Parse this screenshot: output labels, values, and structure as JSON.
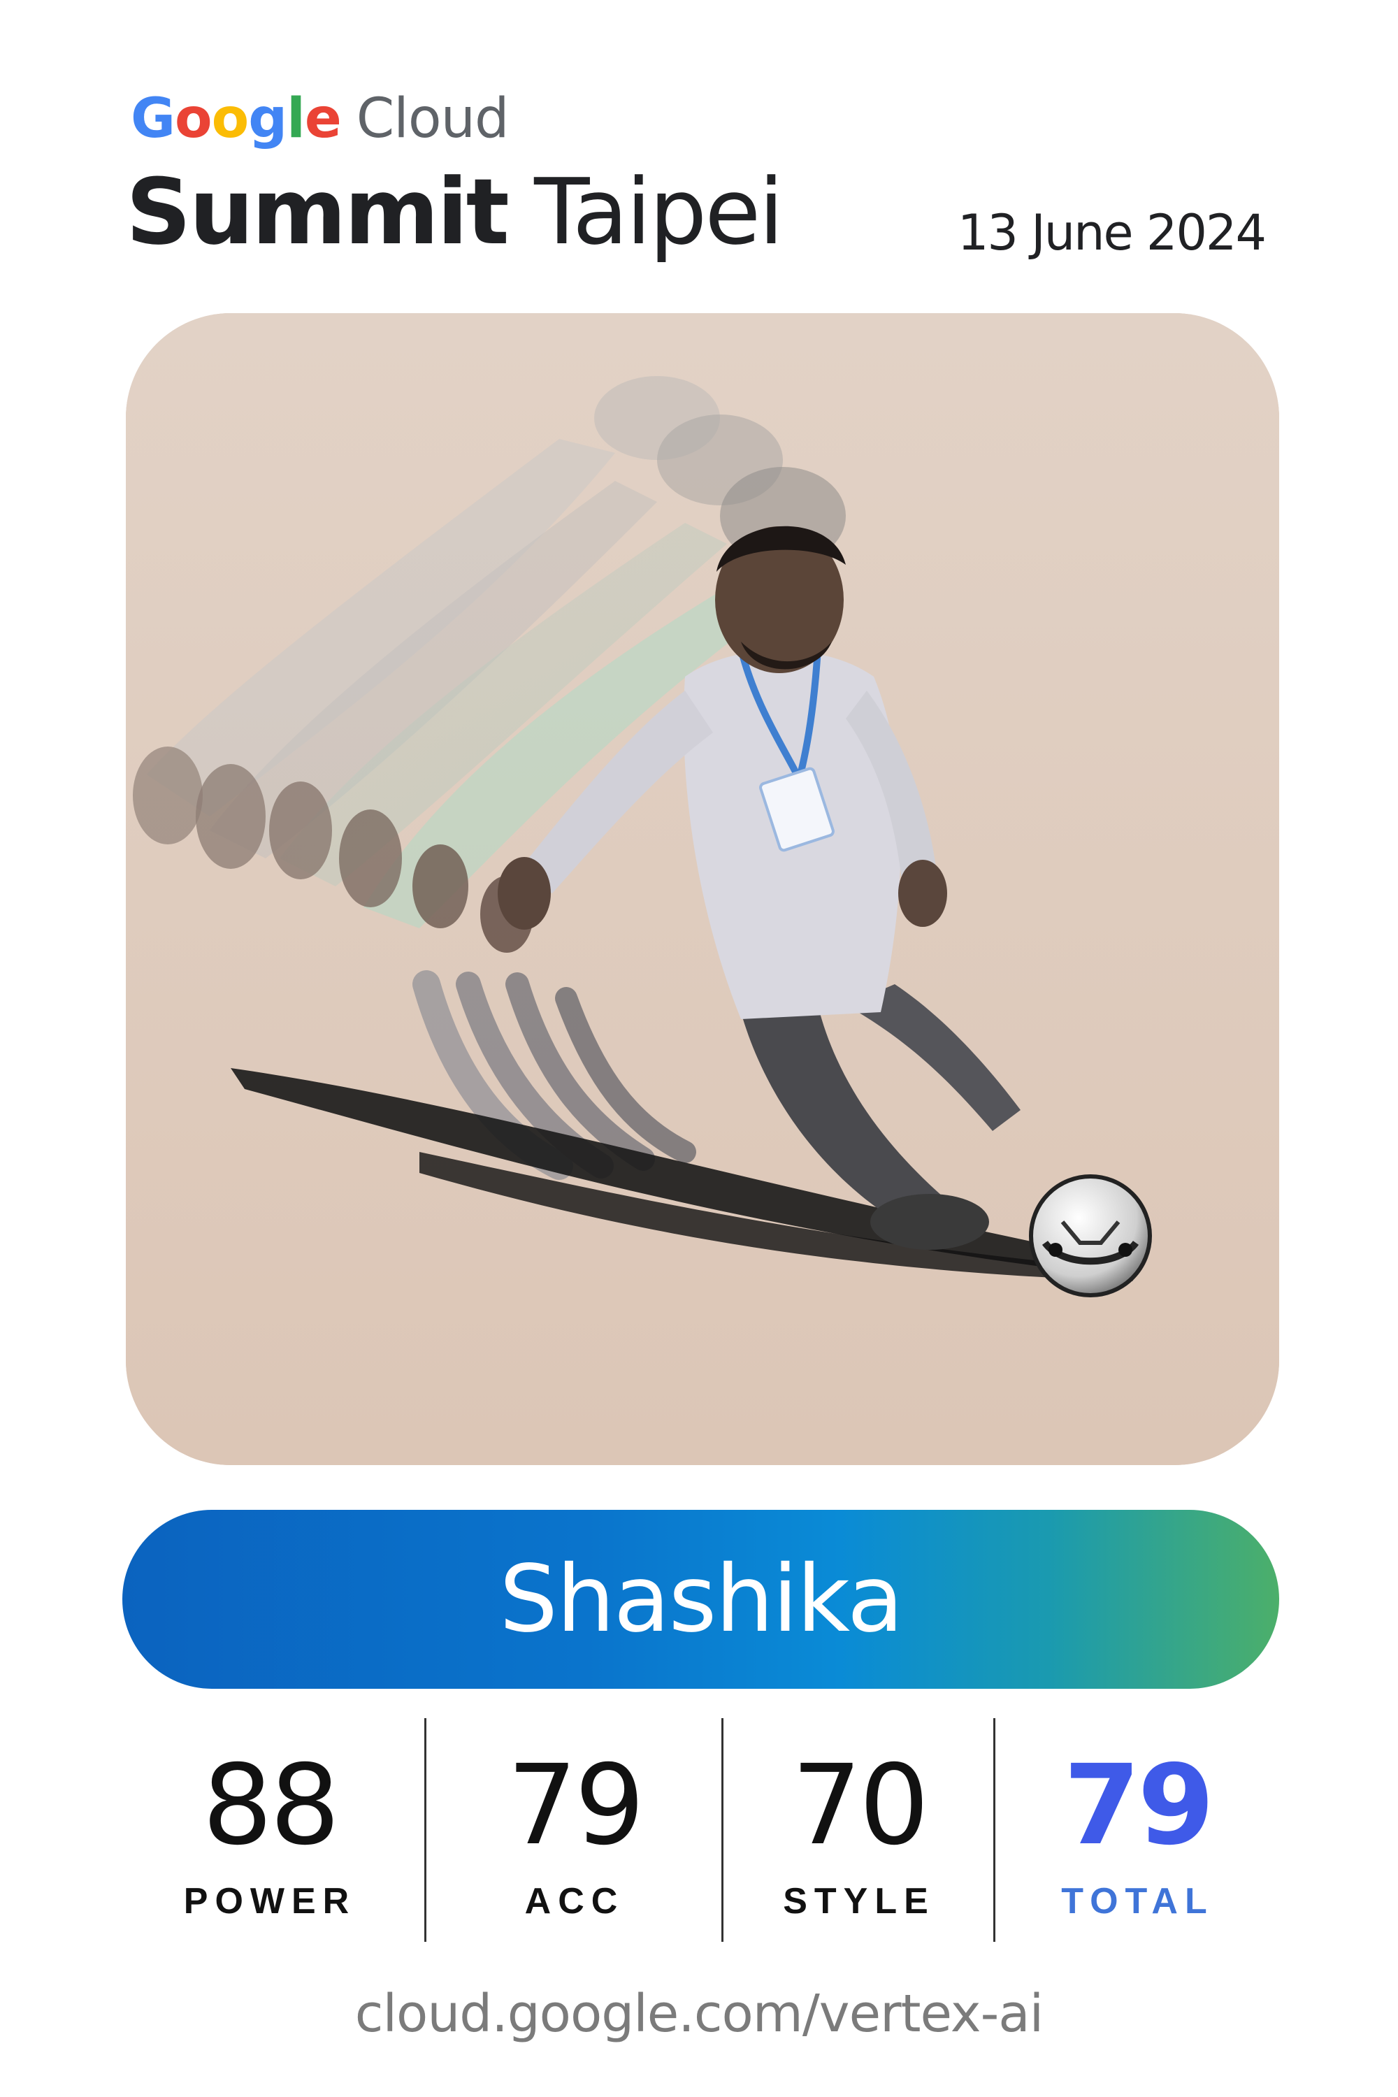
{
  "header": {
    "brand_letters": [
      {
        "ch": "G",
        "color": "#4285F4"
      },
      {
        "ch": "o",
        "color": "#EA4335"
      },
      {
        "ch": "o",
        "color": "#FBBC05"
      },
      {
        "ch": "g",
        "color": "#4285F4"
      },
      {
        "ch": "l",
        "color": "#34A853"
      },
      {
        "ch": "e",
        "color": "#EA4335"
      }
    ],
    "brand_suffix": "Cloud",
    "title_bold": "Summit",
    "title_rest": "Taipei",
    "date": "13 June 2024"
  },
  "photo": {
    "subject": "stylized-photo-soccer-kick"
  },
  "player": {
    "name": "Shashika"
  },
  "stats": [
    {
      "value": "88",
      "label": "POWER"
    },
    {
      "value": "79",
      "label": "ACC"
    },
    {
      "value": "70",
      "label": "STYLE"
    },
    {
      "value": "79",
      "label": "TOTAL"
    }
  ],
  "footer": {
    "url": "cloud.google.com/vertex-ai"
  },
  "colors": {
    "total_value": "#3f5ae8",
    "total_label": "#3f74d8",
    "pill_start": "#0b63bf",
    "pill_end": "#4caf6a",
    "photo_background": "#ddc9bb"
  }
}
